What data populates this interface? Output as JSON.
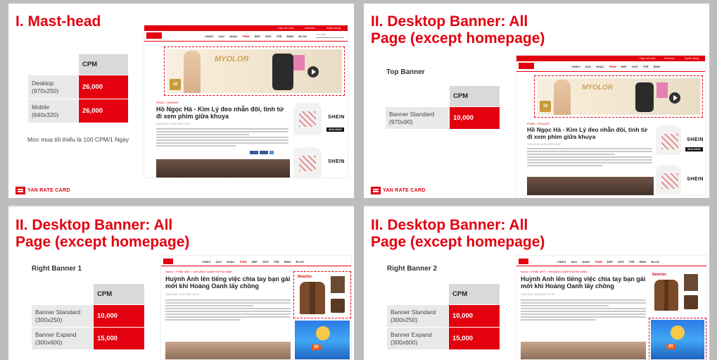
{
  "footer": {
    "brand": "YAN RATE CARD"
  },
  "preview": {
    "topbar": [
      "Hay mê mấn",
      "Weezari",
      "Tuyển dụng"
    ],
    "nav": [
      "VIDEO",
      "SAO",
      "NHẠC",
      "PHIM",
      "ĐẸP",
      "GIỚI",
      "TRẺ",
      "BÌNH",
      "BLOG"
    ],
    "nav_active": "PHIM",
    "search_placeholder": "Tìm kiếm",
    "banner_brand": "MYOLOR",
    "banner_tag": "10",
    "article1": {
      "crumb": "PHIM  >  TRAILER",
      "title": "Hồ Ngọc Hà - Kim Lý đeo nhẫn đôi, tình tứ đi xem phim giữa khuya",
      "meta": "14/11/2018, 20:28 GMT+07:00"
    },
    "article2": {
      "crumb": "Home  >  PHIM VIỆT  >  KHOẢNG OANH HUỲNH ANH",
      "title": "Huỳnh Anh lên tiếng việc chia tay bạn gái mới khi Hoàng Oanh lấy chồng",
      "meta": "13/11/2018, 15:30 GMT+07:00"
    },
    "shein_logo": "SHEIN",
    "shein_buy": "MUA NGAY",
    "newchic": "Newchic",
    "game_badge": "20"
  },
  "slides": [
    {
      "title": "I. Mast-head",
      "table": {
        "header": "CPM",
        "rows": [
          {
            "label": "Desktop",
            "size": "(970x250)",
            "value": "26,000"
          },
          {
            "label": "Mobile",
            "size": "(640x320)",
            "value": "26,000"
          }
        ]
      },
      "note": "Mức mua tối thiểu là 100 CPM/1 Ngày"
    },
    {
      "title_line1": "II. Desktop Banner: All",
      "title_line2": "Page (except homepage)",
      "subtitle": "Top Banner",
      "table": {
        "header": "CPM",
        "rows": [
          {
            "label": "Banner Standard",
            "size": "(970x90)",
            "value": "10,000"
          }
        ]
      }
    },
    {
      "title_line1": "II. Desktop Banner: All",
      "title_line2": "Page (except homepage)",
      "subtitle": "Right Banner 1",
      "table": {
        "header": "CPM",
        "rows": [
          {
            "label": "Banner Standard",
            "size": "(300x250)",
            "value": "10,000"
          },
          {
            "label": "Banner Expand",
            "size": "(300x600)",
            "value": "15,000"
          }
        ]
      }
    },
    {
      "title_line1": "II. Desktop Banner: All",
      "title_line2": "Page (except homepage)",
      "subtitle": "Right Banner 2",
      "table": {
        "header": "CPM",
        "rows": [
          {
            "label": "Banner Standard",
            "size": "(300x250)",
            "value": "10,000"
          },
          {
            "label": "Banner Expand",
            "size": "(300x600)",
            "value": "15,000"
          }
        ]
      }
    }
  ]
}
